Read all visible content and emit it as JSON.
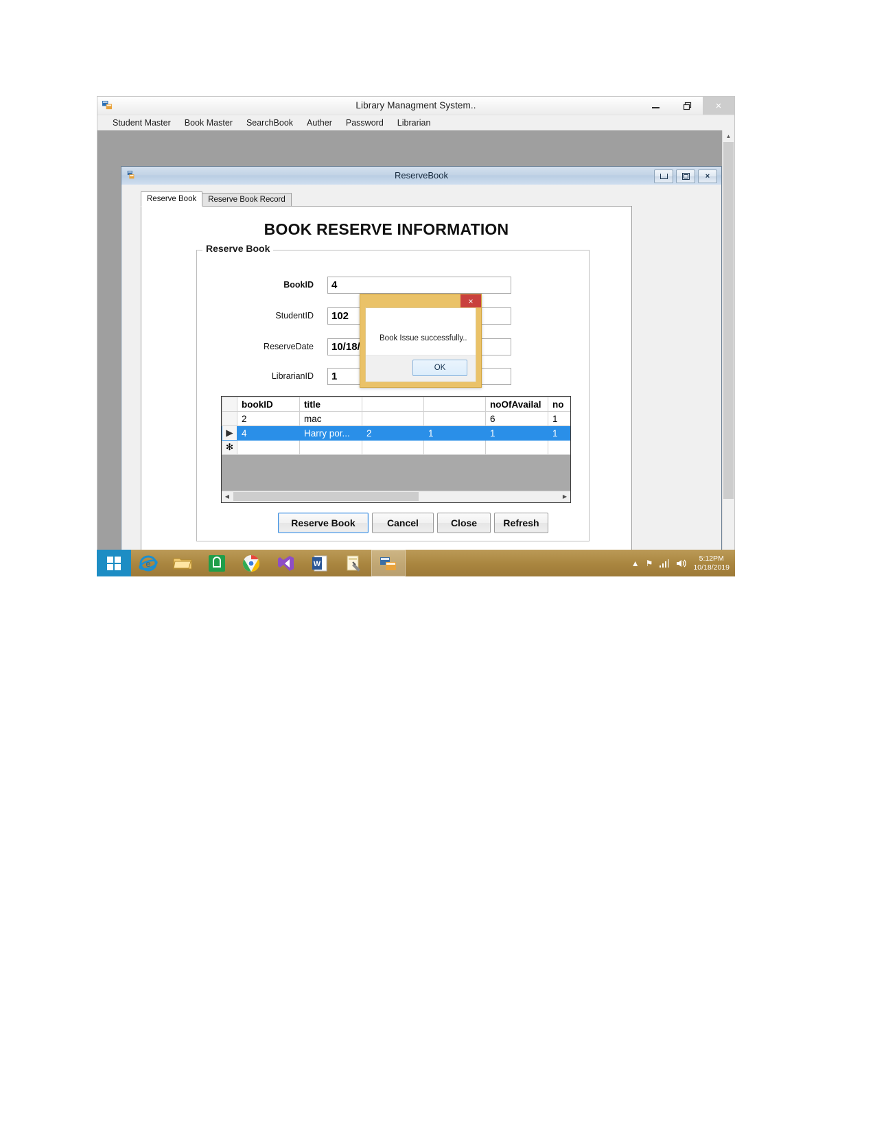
{
  "app": {
    "title": "Library Managment System..",
    "icon": "app-form-icon",
    "window_controls": {
      "minimize": "minimize-icon",
      "maximize": "maximize-icon",
      "close": "close-icon",
      "close_label": "×"
    },
    "menu": [
      {
        "label": "Student Master"
      },
      {
        "label": "Book Master"
      },
      {
        "label": "SearchBook"
      },
      {
        "label": "Auther"
      },
      {
        "label": "Password"
      },
      {
        "label": "Librarian"
      }
    ]
  },
  "child_window": {
    "title": "ReserveBook",
    "icon": "form-icon",
    "controls": {
      "minimize": "minimize-icon",
      "maximize": "maximize-icon",
      "close": "close-icon",
      "close_label": "×"
    }
  },
  "tabs": [
    {
      "label": "Reserve Book",
      "active": true
    },
    {
      "label": "Reserve Book Record",
      "active": false
    }
  ],
  "heading": "BOOK RESERVE INFORMATION",
  "groupbox": {
    "label": "Reserve Book",
    "fields": [
      {
        "label": "BookID",
        "value": "4",
        "bold": true
      },
      {
        "label": "StudentID",
        "value": "102",
        "bold": false
      },
      {
        "label": "ReserveDate",
        "value": "10/18/2019",
        "bold": false
      },
      {
        "label": "LibrarianID",
        "value": "1",
        "bold": false
      }
    ]
  },
  "grid": {
    "columns": [
      "",
      "bookID",
      "title",
      "",
      "",
      "noOfAvailal",
      "no"
    ],
    "rows": [
      {
        "marker": "",
        "cells": [
          "2",
          "mac",
          "",
          "",
          "6",
          "1"
        ],
        "selected": false
      },
      {
        "marker": "▶",
        "cells": [
          "4",
          "Harry por...",
          "2",
          "1",
          "1",
          "1"
        ],
        "selected": true
      },
      {
        "marker": "✻",
        "cells": [
          "",
          "",
          "",
          "",
          "",
          ""
        ],
        "selected": false
      }
    ],
    "hscroll": {
      "left": "◀",
      "right": "▶"
    }
  },
  "buttons": [
    {
      "label": "Reserve Book",
      "focused": true
    },
    {
      "label": "Cancel",
      "focused": false
    },
    {
      "label": "Close",
      "focused": false
    },
    {
      "label": "Refresh",
      "focused": false
    }
  ],
  "messagebox": {
    "text": "Book Issue successfully..",
    "ok_label": "OK",
    "close_label": "×",
    "accent_color": "#eac268",
    "close_color": "#c9413e"
  },
  "mdi_scroll": {
    "up": "▲",
    "down": "▼"
  },
  "taskbar": {
    "start": "windows-start-icon",
    "items": [
      {
        "name": "internet-explorer-icon"
      },
      {
        "name": "file-explorer-icon"
      },
      {
        "name": "windows-store-icon"
      },
      {
        "name": "google-chrome-icon"
      },
      {
        "name": "visual-studio-icon"
      },
      {
        "name": "word-icon"
      },
      {
        "name": "sql-server-icon"
      },
      {
        "name": "library-app-icon"
      }
    ],
    "tray": {
      "show_hidden": "▲",
      "flag": "⚑",
      "network": "network-icon",
      "volume": "volume-icon",
      "time": "5:12PM",
      "date": "10/18/2019"
    }
  }
}
